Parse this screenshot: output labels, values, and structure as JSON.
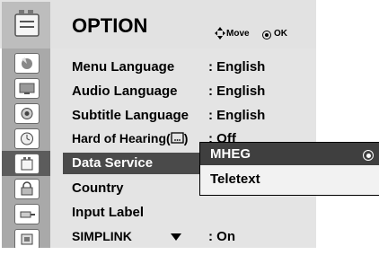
{
  "header": {
    "title": "OPTION",
    "move_hint": "Move",
    "ok_hint": "OK",
    "move_icon": "four-way-arrow-icon",
    "ok_icon": "ok-circle-icon"
  },
  "sidebar_icons": [
    "picture-icon",
    "screen-icon",
    "audio-icon",
    "clock-icon",
    "option-icon",
    "lock-icon",
    "input-icon",
    "usb-icon"
  ],
  "menu": {
    "items": [
      {
        "label": "Menu Language",
        "value": ": English"
      },
      {
        "label": "Audio Language",
        "value": ": English"
      },
      {
        "label": "Subtitle Language",
        "value": ": English"
      },
      {
        "label": "Hard of Hearing(",
        "label_icon": "hearing-impaired-icon",
        "label_end": ")",
        "value": ": Off"
      },
      {
        "label": "Data Service",
        "value": "",
        "selected": true
      },
      {
        "label": "Country",
        "value": ""
      },
      {
        "label": "Input Label",
        "value": ""
      },
      {
        "label": "SIMPLINK",
        "value": ": On"
      }
    ]
  },
  "popup": {
    "options": [
      {
        "label": "MHEG",
        "selected": true
      },
      {
        "label": "Teletext",
        "selected": false
      }
    ]
  },
  "colors": {
    "selected_row": "#4a4a4a",
    "header_bg": "#e2e2e2",
    "list_bg": "#e4e4e4",
    "icon_col": "#a9a9a9"
  }
}
